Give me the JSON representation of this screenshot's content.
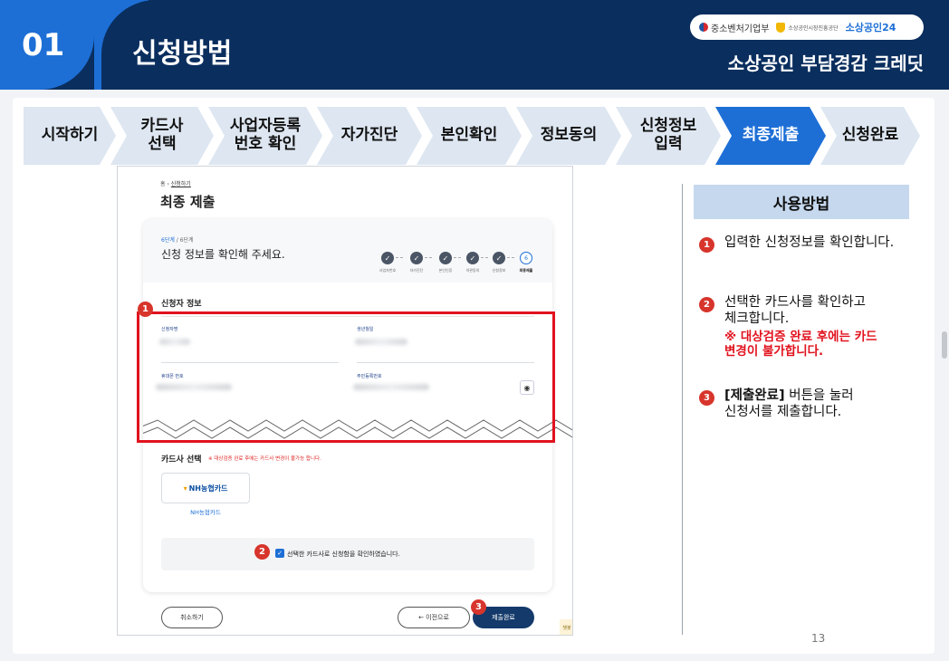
{
  "header": {
    "number": "01",
    "title": "신청방법",
    "subtitle": "소상공인 부담경감 크레딧",
    "logos": {
      "ministry": "중소벤처기업부",
      "agency": "소상공인시장진흥공단",
      "portal": "소상공인24"
    }
  },
  "steps": [
    {
      "label": "시작하기"
    },
    {
      "label": "카드사\n선택"
    },
    {
      "label": "사업자등록\n번호 확인"
    },
    {
      "label": "자가진단"
    },
    {
      "label": "본인확인"
    },
    {
      "label": "정보동의"
    },
    {
      "label": "신청정보\n입력"
    },
    {
      "label": "최종제출"
    },
    {
      "label": "신청완료"
    }
  ],
  "active_step": "최종제출",
  "screenshot": {
    "breadcrumb_home": "홈",
    "breadcrumb_link": "신청하기",
    "title": "최종 제출",
    "step_current": "6단계",
    "step_total": " / 6단계",
    "heading": "신청 정보를 확인해 주세요.",
    "mini_steps": [
      {
        "mark": "✓",
        "label": "사업자번호"
      },
      {
        "mark": "✓",
        "label": "자가진단"
      },
      {
        "mark": "✓",
        "label": "본인인증"
      },
      {
        "mark": "✓",
        "label": "약관동의"
      },
      {
        "mark": "✓",
        "label": "신청정보"
      },
      {
        "mark": "6",
        "label": "최종제출"
      }
    ],
    "section_applicant": "신청자 정보",
    "fields": {
      "name": "신청자명",
      "birth": "생년월일",
      "phone": "휴대폰 번호",
      "rrn": "주민등록번호"
    },
    "card_select": "카드사 선택",
    "card_warning": "※ 대상검증 완료 후에는 카드사 변경이 불가능 합니다.",
    "card_logo": "NH농협카드",
    "card_name": "NH농협카드",
    "confirm_text": "선택한 카드사로 신청함을 확인하였습니다.",
    "btn_cancel": "취소하기",
    "btn_prev": "← 이전으로",
    "btn_submit": "제출완료",
    "corner_text": "챗봇"
  },
  "badges": [
    "1",
    "2",
    "3"
  ],
  "usage": {
    "title": "사용방법",
    "items": [
      {
        "num": "1",
        "text": "입력한 신청정보를 확인합니다."
      },
      {
        "num": "2",
        "text": "선택한 카드사를 확인하고\n체크합니다.",
        "warning": "※ 대상검증 완료 후에는 카드\n변경이 불가합니다."
      },
      {
        "num": "3",
        "bold": "[제출완료]",
        "text": " 버튼을 눌러\n신청서를 제출합니다."
      }
    ]
  },
  "page_number": "13",
  "colors": {
    "navy": "#0a2e5e",
    "blue": "#1d6fd6",
    "step_bg": "#dde6f1",
    "red": "#e1121e"
  }
}
